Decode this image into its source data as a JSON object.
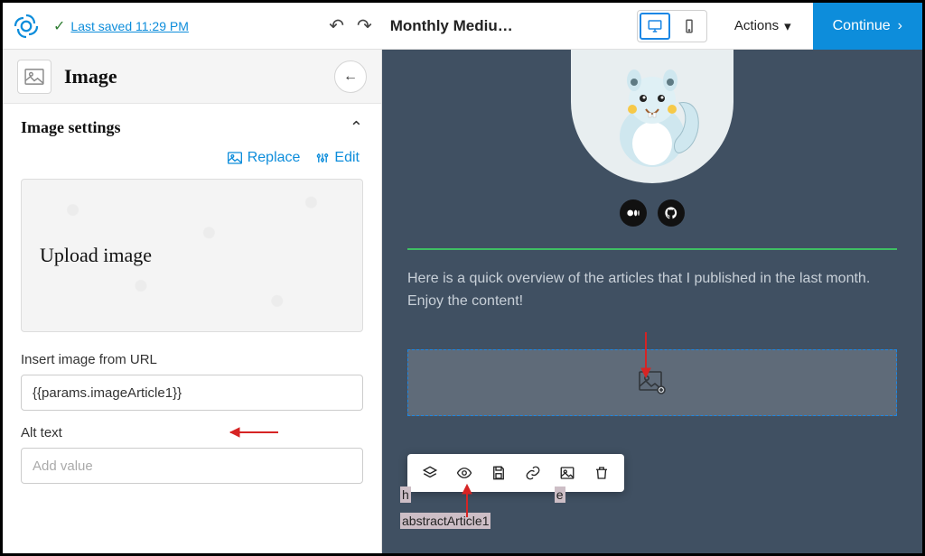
{
  "top": {
    "saved_text": "Last saved 11:29 PM",
    "doc_title": "Monthly Mediu…",
    "actions_label": "Actions",
    "continue_label": "Continue"
  },
  "sidebar": {
    "panel_title": "Image",
    "section_title": "Image settings",
    "replace_label": "Replace",
    "edit_label": "Edit",
    "upload_label": "Upload image",
    "url_label": "Insert image from URL",
    "url_value": "{{params.imageArticle1}}",
    "alt_label": "Alt text",
    "alt_placeholder": "Add value"
  },
  "canvas": {
    "intro_text": "Here is a quick overview of the articles that I published in the last month. Enjoy the content!",
    "placeholder_line1_partial": "h",
    "placeholder_line1_end": "e",
    "placeholder_line2": "abstractArticle1"
  },
  "icons": {
    "logo": "app-logo",
    "desktop": "desktop-icon",
    "mobile": "mobile-icon",
    "medium": "medium-icon",
    "github": "github-icon"
  }
}
